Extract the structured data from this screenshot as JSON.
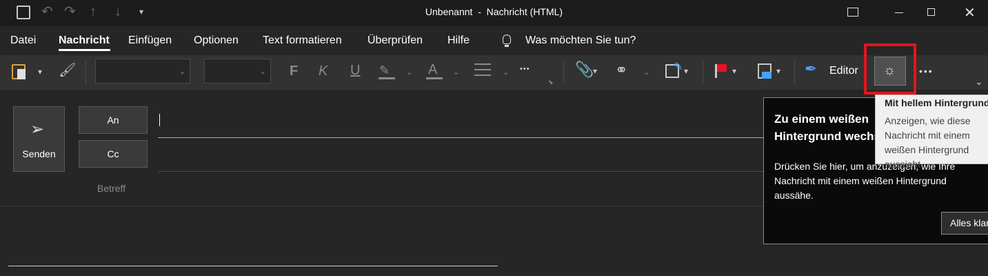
{
  "window": {
    "title": "Unbenannt  -  Nachricht (HTML)"
  },
  "menu": {
    "items": [
      "Datei",
      "Nachricht",
      "Einfügen",
      "Optionen",
      "Text formatieren",
      "Überprüfen",
      "Hilfe"
    ],
    "search_text": "Was möchten Sie tun?"
  },
  "toolbar": {
    "bold": "F",
    "italic": "K",
    "underline": "U",
    "font_color_glyph": "A",
    "more": "•••",
    "editor_label": "Editor"
  },
  "compose": {
    "send_label": "Senden",
    "to_label": "An",
    "cc_label": "Cc",
    "subject_label": "Betreff"
  },
  "callout": {
    "title": "Zu einem weißen Hintergrund wechseln",
    "body": "Drücken Sie hier, um anzuzeigen, wie Ihre Nachricht mit einem weißen Hintergrund aussähe.",
    "button": "Alles klar"
  },
  "tooltip": {
    "title": "Mit hellem Hintergrund",
    "body": "Anzeigen, wie diese Nachricht mit einem weißen Hintergrund aussieht."
  },
  "colors": {
    "highlight_border": "#e0161d",
    "flag": "#e81123"
  }
}
